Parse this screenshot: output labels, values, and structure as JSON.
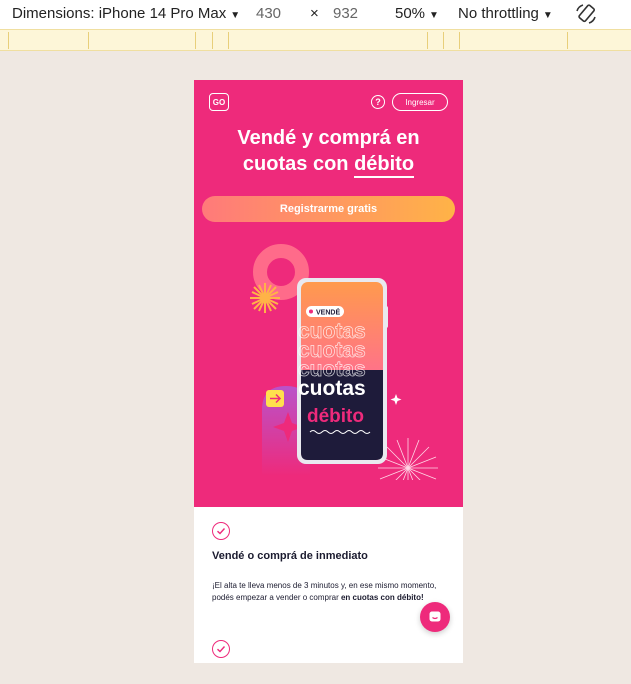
{
  "devtools": {
    "dimensions_label": "Dimensions: iPhone 14 Pro Max",
    "width": "430",
    "times": "×",
    "height": "932",
    "zoom": "50%",
    "throttling": "No throttling"
  },
  "header": {
    "logo_text": "GO",
    "help_symbol": "?",
    "login_label": "Ingresar"
  },
  "hero": {
    "headline_part1": "Vendé y comprá en",
    "headline_part2": "cuotas con ",
    "headline_underlined": "débito",
    "cta_label": "Registrarme gratis"
  },
  "illustration": {
    "badge": "VENDÉ",
    "repeat_word": "cuotas",
    "main_word": "cuotas",
    "accent_word": "débito",
    "colors": {
      "pink": "#ee2a7b",
      "dark": "#1e1b3a",
      "orange": "#ffb347",
      "yellow": "#ffe14d"
    }
  },
  "feature": {
    "title": "Vendé o comprá de inmediato",
    "body_prefix": "¡El alta te lleva menos de 3 minutos y, en ese mismo momento, podés empezar a vender o comprar ",
    "body_bold": "en cuotas con débito!"
  },
  "icons": [
    "check-circle-icon",
    "chat-icon",
    "rotate-icon",
    "help-icon"
  ]
}
